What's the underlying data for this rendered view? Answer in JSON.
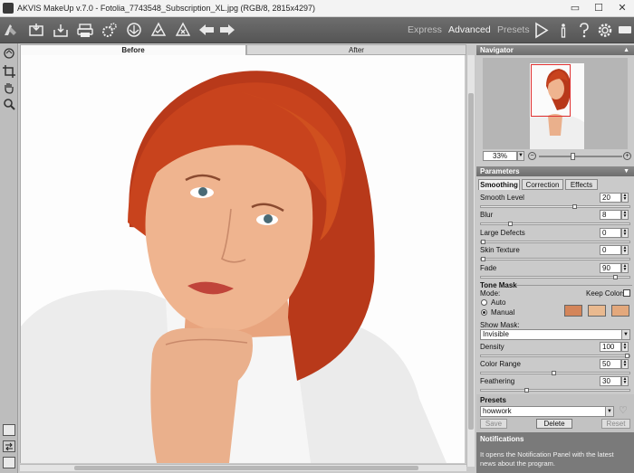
{
  "window": {
    "title": "AKVIS MakeUp v.7.0 - Fotolia_7743548_Subscription_XL.jpg (RGB/8, 2815x4297)",
    "minimize_glyph": "▭",
    "maximize_glyph": "☐",
    "close_glyph": "✕"
  },
  "toolbar": {
    "icons": [
      "home-icon",
      "open-image-icon",
      "save-image-icon",
      "print-icon",
      "batch-processing-icon",
      "share-icon",
      "apply-icon",
      "cancel-icon",
      "back-icon",
      "forward-icon"
    ],
    "modes": [
      "Express",
      "Advanced",
      "Presets"
    ],
    "active_mode": "Advanced",
    "right_icons": [
      "run-icon",
      "info-icon",
      "help-icon",
      "settings-icon",
      "message-icon"
    ]
  },
  "left_tools": [
    "retouch-brush-icon",
    "crop-icon",
    "hand-icon",
    "zoom-icon"
  ],
  "left_bottom": [
    "view-single-icon",
    "view-split-icon",
    "view-full-icon"
  ],
  "view_tabs": {
    "before": "Before",
    "after": "After"
  },
  "navigator": {
    "title": "Navigator",
    "zoom_value": "33%",
    "zoom_out": "−",
    "zoom_in": "+",
    "zoom_level": 0.33
  },
  "parameters": {
    "title": "Parameters",
    "tabs": [
      "Smoothing",
      "Correction",
      "Effects"
    ],
    "active_tab": "Smoothing",
    "rows": [
      {
        "label": "Smooth Level",
        "value": "20"
      },
      {
        "label": "Blur",
        "value": "8"
      },
      {
        "label": "Large Defects",
        "value": "0"
      },
      {
        "label": "Skin Texture",
        "value": "0"
      },
      {
        "label": "Fade",
        "value": "90"
      }
    ],
    "tone_mask": {
      "title": "Tone Mask",
      "mode_label": "Mode:",
      "keep_colors_label": "Keep Colors",
      "auto_label": "Auto",
      "manual_label": "Manual",
      "selected": "Manual",
      "swatches": [
        "#d4855a",
        "#e9b98f",
        "#e3a87c"
      ],
      "show_mask_label": "Show Mask:",
      "show_mask_value": "Invisible",
      "rows": [
        {
          "label": "Density",
          "value": "100"
        },
        {
          "label": "Color Range",
          "value": "50"
        },
        {
          "label": "Feathering",
          "value": "30"
        }
      ]
    }
  },
  "presets": {
    "title": "Presets",
    "value": "howwork",
    "save": "Save",
    "delete": "Delete",
    "reset": "Reset"
  },
  "notifications": {
    "title": "Notifications",
    "text": "It opens the Notification Panel with the latest news about the program."
  },
  "colors": {
    "hair": "#c23f1b",
    "skin": "#efb48f",
    "toolbar": "#5e5e5e",
    "panel": "#cacaca"
  }
}
